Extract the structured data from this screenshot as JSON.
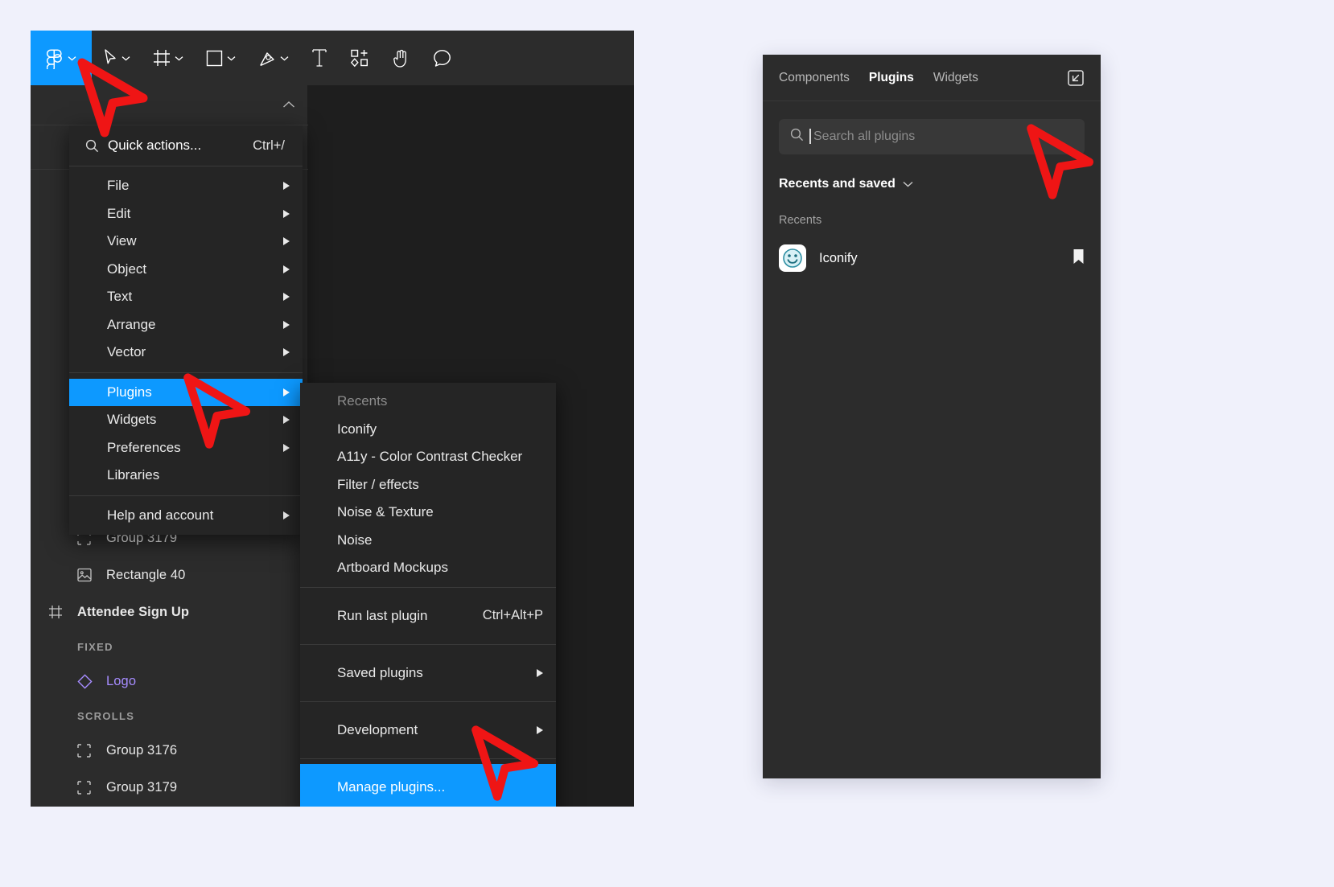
{
  "toolbar": {
    "items": [
      {
        "name": "figma-logo",
        "icon": "figma-logo-icon",
        "has_chevron": true,
        "active": true
      },
      {
        "name": "move-tool",
        "icon": "cursor-arrow-icon",
        "has_chevron": true,
        "active": false
      },
      {
        "name": "frame-tool",
        "icon": "frame-icon",
        "has_chevron": true,
        "active": false
      },
      {
        "name": "shape-tool",
        "icon": "rectangle-icon",
        "has_chevron": true,
        "active": false
      },
      {
        "name": "pen-tool",
        "icon": "pen-icon",
        "has_chevron": true,
        "active": false
      },
      {
        "name": "text-tool",
        "icon": "text-t-icon",
        "has_chevron": false,
        "active": false
      },
      {
        "name": "actions-tool",
        "icon": "components-icon",
        "has_chevron": false,
        "active": false
      },
      {
        "name": "hand-tool",
        "icon": "hand-icon",
        "has_chevron": false,
        "active": false
      },
      {
        "name": "comment-tool",
        "icon": "comment-bubble-icon",
        "has_chevron": false,
        "active": false
      }
    ]
  },
  "main_menu": {
    "quick_actions": {
      "label": "Quick actions...",
      "shortcut": "Ctrl+/",
      "icon": "search-icon"
    },
    "groups": [
      {
        "items": [
          {
            "label": "File",
            "submenu": true,
            "selected": false
          },
          {
            "label": "Edit",
            "submenu": true,
            "selected": false
          },
          {
            "label": "View",
            "submenu": true,
            "selected": false
          },
          {
            "label": "Object",
            "submenu": true,
            "selected": false
          },
          {
            "label": "Text",
            "submenu": true,
            "selected": false
          },
          {
            "label": "Arrange",
            "submenu": true,
            "selected": false
          },
          {
            "label": "Vector",
            "submenu": true,
            "selected": false
          }
        ]
      },
      {
        "items": [
          {
            "label": "Plugins",
            "submenu": true,
            "selected": true
          },
          {
            "label": "Widgets",
            "submenu": true,
            "selected": false
          },
          {
            "label": "Preferences",
            "submenu": true,
            "selected": false
          },
          {
            "label": "Libraries",
            "submenu": false,
            "selected": false
          }
        ]
      },
      {
        "items": [
          {
            "label": "Help and account",
            "submenu": true,
            "selected": false
          }
        ]
      }
    ]
  },
  "plugins_submenu": {
    "groups": [
      {
        "tall": false,
        "items": [
          {
            "label": "Recents",
            "header": true,
            "submenu": false,
            "shortcut": "",
            "selected": false
          },
          {
            "label": "Iconify",
            "header": false,
            "submenu": false,
            "shortcut": "",
            "selected": false
          },
          {
            "label": "A11y - Color Contrast Checker",
            "header": false,
            "submenu": false,
            "shortcut": "",
            "selected": false
          },
          {
            "label": "Filter / effects",
            "header": false,
            "submenu": false,
            "shortcut": "",
            "selected": false
          },
          {
            "label": "Noise & Texture",
            "header": false,
            "submenu": false,
            "shortcut": "",
            "selected": false
          },
          {
            "label": "Noise",
            "header": false,
            "submenu": false,
            "shortcut": "",
            "selected": false
          },
          {
            "label": "Artboard Mockups",
            "header": false,
            "submenu": false,
            "shortcut": "",
            "selected": false
          }
        ]
      },
      {
        "tall": true,
        "items": [
          {
            "label": "Run last plugin",
            "header": false,
            "submenu": false,
            "shortcut": "Ctrl+Alt+P",
            "selected": false
          }
        ]
      },
      {
        "tall": true,
        "items": [
          {
            "label": "Saved plugins",
            "header": false,
            "submenu": true,
            "shortcut": "",
            "selected": false
          }
        ]
      },
      {
        "tall": true,
        "items": [
          {
            "label": "Development",
            "header": false,
            "submenu": true,
            "shortcut": "",
            "selected": false
          }
        ]
      },
      {
        "tall": true,
        "items": [
          {
            "label": "Manage plugins...",
            "header": false,
            "submenu": false,
            "shortcut": "",
            "selected": true
          }
        ]
      }
    ]
  },
  "layers": [
    {
      "type": "layer",
      "label": "Group 3179",
      "icon": "group-icon",
      "bold": false,
      "purple": false
    },
    {
      "type": "layer",
      "label": "Rectangle 40",
      "icon": "image-icon",
      "bold": false,
      "purple": false
    },
    {
      "type": "frame",
      "label": "Attendee Sign Up",
      "icon": "frame-icon",
      "bold": true,
      "purple": false
    },
    {
      "type": "section",
      "label": "FIXED"
    },
    {
      "type": "layer",
      "label": "Logo",
      "icon": "component-diamond-icon",
      "bold": false,
      "purple": true
    },
    {
      "type": "section",
      "label": "SCROLLS"
    },
    {
      "type": "layer",
      "label": "Group 3176",
      "icon": "group-icon",
      "bold": false,
      "purple": false
    },
    {
      "type": "layer",
      "label": "Group 3179",
      "icon": "group-icon",
      "bold": false,
      "purple": false
    }
  ],
  "plugins_panel": {
    "tabs": [
      {
        "label": "Components",
        "active": false
      },
      {
        "label": "Plugins",
        "active": true
      },
      {
        "label": "Widgets",
        "active": false
      }
    ],
    "expand_icon": "expand-panel-icon",
    "search": {
      "placeholder": "Search all plugins",
      "value": "",
      "icon": "search-icon"
    },
    "filter": {
      "label": "Recents and saved",
      "icon": "chevron-down-icon"
    },
    "section_label": "Recents",
    "plugin_items": [
      {
        "name": "Iconify",
        "icon": "smiley-face-icon",
        "bookmark_icon": "bookmark-filled-icon"
      }
    ]
  },
  "colors": {
    "accent": "#0d99ff",
    "panel_bg": "#2c2c2c",
    "menu_bg": "#252525",
    "canvas_bg": "#1e1e1e",
    "page_bg": "#f0f1fb",
    "cursor_red": "#ef1515",
    "purple_layer": "#a68cff"
  }
}
